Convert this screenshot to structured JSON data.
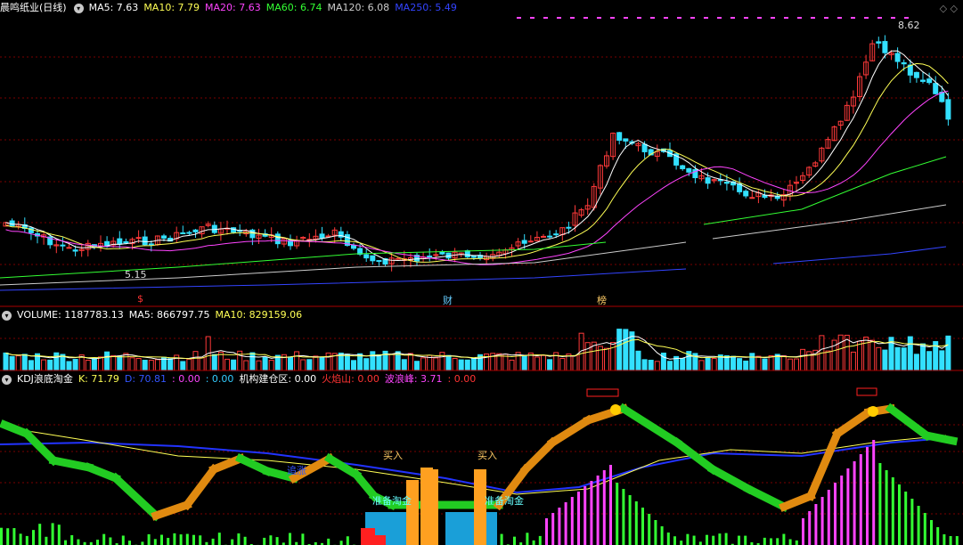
{
  "main": {
    "title": "晨鸣纸业(日线)",
    "ma": [
      {
        "label": "MA5: 7.63",
        "color": "#ffffff"
      },
      {
        "label": "MA10: 7.79",
        "color": "#ffff55"
      },
      {
        "label": "MA20: 7.63",
        "color": "#ff44ff"
      },
      {
        "label": "MA60: 6.74",
        "color": "#33ff33"
      },
      {
        "label": "MA120: 6.08",
        "color": "#cccccc"
      },
      {
        "label": "MA250: 5.49",
        "color": "#3344ff"
      }
    ],
    "high_label": "8.62",
    "low_label": "5.15",
    "markers": [
      {
        "label": "$",
        "color": "#ff3333"
      },
      {
        "label": "财",
        "color": "#66ccff"
      },
      {
        "label": "榜",
        "color": "#ffcc66"
      }
    ],
    "top_icons": "◇ ◇"
  },
  "volume": {
    "items": [
      {
        "label": "VOLUME: 1187783.13",
        "color": "#ffffff"
      },
      {
        "label": "MA5: 866797.75",
        "color": "#ffffff"
      },
      {
        "label": "MA10: 829159.06",
        "color": "#ffff55"
      }
    ]
  },
  "kdj": {
    "items": [
      {
        "label": "KDJ浪底淘金",
        "color": "#ffffff"
      },
      {
        "label": "K: 71.79",
        "color": "#ffff55"
      },
      {
        "label": "D: 70.81",
        "color": "#3355ff"
      },
      {
        "label": ": 0.00",
        "color": "#ff44ff"
      },
      {
        "label": ": 0.00",
        "color": "#33ccff"
      },
      {
        "label": "机构建仓区: 0.00",
        "color": "#ffffff"
      },
      {
        "label": "火焰山: 0.00",
        "color": "#ff3333"
      },
      {
        "label": "波浪峰: 3.71",
        "color": "#ff44ff"
      },
      {
        "label": ": 0.00",
        "color": "#ff3333"
      }
    ],
    "labels": {
      "buy1": "买入",
      "buy2": "买入",
      "chase": "追涨",
      "zhun1": "准备淘金",
      "zhun2": "准备淘金"
    }
  },
  "colors": {
    "up": "#ff3a3a",
    "down": "#33e0ff",
    "grid": "#7a0000",
    "wave_green": "#22cc22",
    "wave_orange": "#e08a10",
    "bar_orange": "#ffa020",
    "zone_blue": "#1a9fd8"
  }
}
